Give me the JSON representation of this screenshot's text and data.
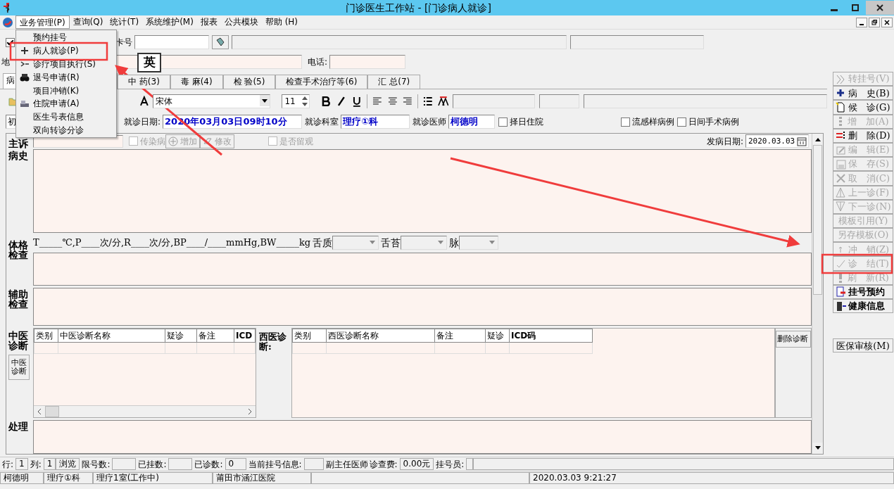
{
  "window": {
    "title": "门诊医生工作站 - [门诊病人就诊]"
  },
  "menu_bar": [
    {
      "label": "业务管理(P)",
      "selected": true
    },
    {
      "label": "查询(Q)",
      "selected": false
    },
    {
      "label": "统计(T)",
      "selected": false
    },
    {
      "label": "系统维护(M)",
      "selected": false
    },
    {
      "label": "报表",
      "selected": false
    },
    {
      "label": "公共模块",
      "selected": false
    },
    {
      "label": "帮助 (H)",
      "selected": false
    }
  ],
  "open_menu": [
    "预约挂号",
    "病人就诊(P)",
    "诊疗项目执行(S)",
    "退号申请(R)",
    "项目冲销(K)",
    "住院申请(A)",
    "医生号表信息",
    "双向转诊分诊"
  ],
  "patient_bar": {
    "checked": true,
    "card_label": "卡号",
    "address_label": "地",
    "ime_indicator": "英",
    "phone_label": "电话:"
  },
  "tabs": [
    {
      "label": "病",
      "selected": true
    },
    {
      "label": "中 药(3)",
      "selected": false
    },
    {
      "label": "毒 麻(4)",
      "selected": false
    },
    {
      "label": "检 验(5)",
      "selected": false
    },
    {
      "label": "检查手术治疗等(6)",
      "selected": false
    },
    {
      "label": "汇 总(7)",
      "selected": false
    }
  ],
  "format_toolbar": {
    "font": "宋体",
    "size": "11"
  },
  "visit_info": {
    "first_field": "初",
    "date_label": "就诊日期:",
    "date": "2020年03月03日09时10分",
    "dept_label": "就诊科室",
    "dept": "理疗①科",
    "doctor_label": "就诊医师",
    "doctor": "柯德明",
    "checkboxes": [
      {
        "label": "择日住院",
        "checked": false
      },
      {
        "label": "流感样病例",
        "checked": false
      },
      {
        "label": "日间手术病例",
        "checked": false
      }
    ]
  },
  "record": {
    "complaint_label": "主诉",
    "complaint_options": [
      {
        "kind": "checkbox",
        "label": "传染病",
        "disabled": true,
        "checked": false
      },
      {
        "kind": "button",
        "label": "增加",
        "disabled": true
      },
      {
        "kind": "button",
        "label": "修改",
        "disabled": true
      },
      {
        "kind": "checkbox",
        "label": "是否留观",
        "disabled": true,
        "checked": false
      }
    ],
    "onset_label": "发病日期:",
    "onset": "2020.03.03",
    "history_label": "病史",
    "exam_label": "体格检查",
    "vitals": "T_____℃,P____次/分,R____次/分,BP____/____mmHg,BW_____kg",
    "vital_selects": [
      "舌质",
      "舌苔",
      "脉"
    ],
    "aux_label": "辅助检查",
    "tcm_label": "中医诊断",
    "tcm_button": "中医诊断",
    "tcm_columns": [
      "类别",
      "中医诊断名称",
      "疑诊",
      "备注",
      "ICD"
    ],
    "western_label": "西医诊断:",
    "western_columns": [
      "类别",
      "西医诊断名称",
      "备注",
      "疑诊",
      "ICD码"
    ],
    "delete_button": "删除诊断",
    "treatment_label": "处理"
  },
  "side_buttons": [
    {
      "label": "转挂号(V)",
      "disabled": true
    },
    {
      "label": "病　史(B)",
      "disabled": false
    },
    {
      "label": "候　诊(G)",
      "disabled": false
    },
    {
      "label": "增　加(A)",
      "disabled": true
    },
    {
      "label": "删　除(D)",
      "disabled": false
    },
    {
      "label": "编　辑(E)",
      "disabled": true
    },
    {
      "label": "保　存(S)",
      "disabled": true
    },
    {
      "label": "取　消(C)",
      "disabled": true
    },
    {
      "label": "上一诊(F)",
      "disabled": true
    },
    {
      "label": "下一诊(N)",
      "disabled": true
    },
    {
      "label": "模板引用(Y)",
      "disabled": true
    },
    {
      "label": "另存模板(O)",
      "disabled": true
    },
    {
      "label": "冲　销(Z)",
      "disabled": true
    },
    {
      "label": "诊　结(T)",
      "disabled": true
    },
    {
      "label": "刷　新(R)",
      "disabled": true
    },
    {
      "label": "挂号预约",
      "disabled": false
    },
    {
      "label": "健康信息",
      "disabled": false
    }
  ],
  "insurance_button": "医保审核(M)",
  "status_bar": [
    {
      "kind": "label",
      "text": "行:"
    },
    {
      "kind": "value",
      "text": "1"
    },
    {
      "kind": "label",
      "text": "列:"
    },
    {
      "kind": "value",
      "text": "1"
    },
    {
      "kind": "value",
      "text": "浏览"
    },
    {
      "kind": "label",
      "text": "限号数:"
    },
    {
      "kind": "value"
    },
    {
      "kind": "label",
      "text": "已挂数:"
    },
    {
      "kind": "value"
    },
    {
      "kind": "label",
      "text": "已诊数:"
    },
    {
      "kind": "value",
      "text": "0"
    },
    {
      "kind": "label",
      "text": "当前挂号信息:"
    },
    {
      "kind": "value"
    },
    {
      "kind": "label",
      "text": "副主任医师"
    },
    {
      "kind": "label",
      "text": "诊查费:"
    },
    {
      "kind": "value",
      "text": "0.00元"
    },
    {
      "kind": "label",
      "text": "挂号员:"
    },
    {
      "kind": "value"
    }
  ],
  "info_bar": [
    {
      "kind": "text",
      "text": "柯德明"
    },
    {
      "kind": "text",
      "text": "理疗①科"
    },
    {
      "kind": "text",
      "text": "理疗1室(工作中)"
    },
    {
      "kind": "text",
      "text": "莆田市涵江医院"
    },
    {
      "kind": "blank"
    },
    {
      "kind": "text",
      "text": "2020.03.03 9:21:27"
    }
  ]
}
